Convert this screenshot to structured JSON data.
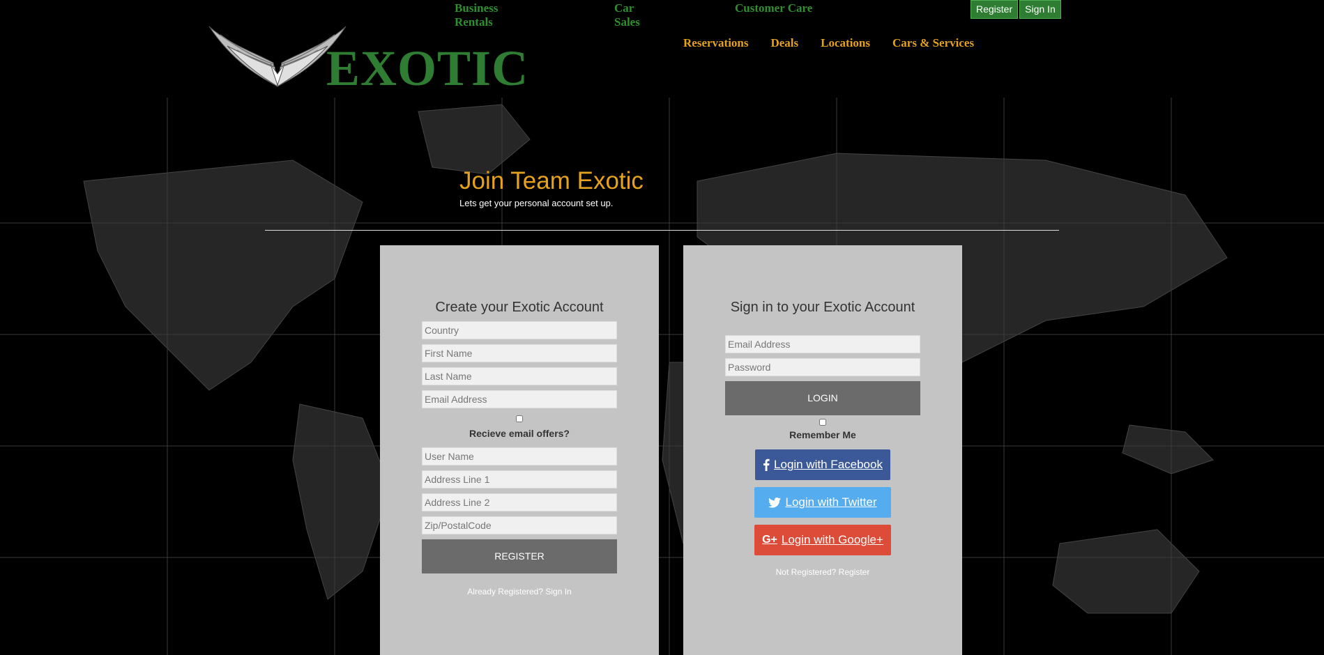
{
  "top_links": [
    "Business Rentals",
    "Car Sales",
    "Customer Care"
  ],
  "auth": {
    "register": "Register",
    "sign_in": "Sign In"
  },
  "logo": {
    "text": "EXOTIC"
  },
  "main_nav": [
    "Reservations",
    "Deals",
    "Locations",
    "Cars & Services"
  ],
  "hero": {
    "title": "Join Team Exotic",
    "subtitle": "Lets get your personal account set up."
  },
  "register_panel": {
    "heading": "Create your Exotic Account",
    "fields": {
      "country": "Country",
      "first_name": "First Name",
      "last_name": "Last Name",
      "email": "Email Address",
      "user_name": "User Name",
      "address1": "Address Line 1",
      "address2": "Address Line 2",
      "zip": "Zip/PostalCode"
    },
    "offers_label": "Recieve email offers?",
    "button": "REGISTER",
    "footer_text": "Already Registered? ",
    "footer_link": "Sign In"
  },
  "login_panel": {
    "heading": "Sign in to your Exotic Account",
    "fields": {
      "email": "Email Address",
      "password": "Password"
    },
    "button": "LOGIN",
    "remember_label": "Remember Me",
    "facebook": "Login with Facebook",
    "twitter": "Login with Twitter",
    "google": "Login with Google+",
    "footer_text": "Not Registered? ",
    "footer_link": "Register"
  },
  "colors": {
    "green": "#2e7d32",
    "gold": "#e6a21c",
    "panel": "#c4c4c4",
    "facebook": "#3b5998",
    "twitter": "#55acee",
    "google": "#dd4b39"
  },
  "icons": [
    "wings-logo-icon",
    "facebook-icon",
    "twitter-icon",
    "google-plus-icon"
  ]
}
